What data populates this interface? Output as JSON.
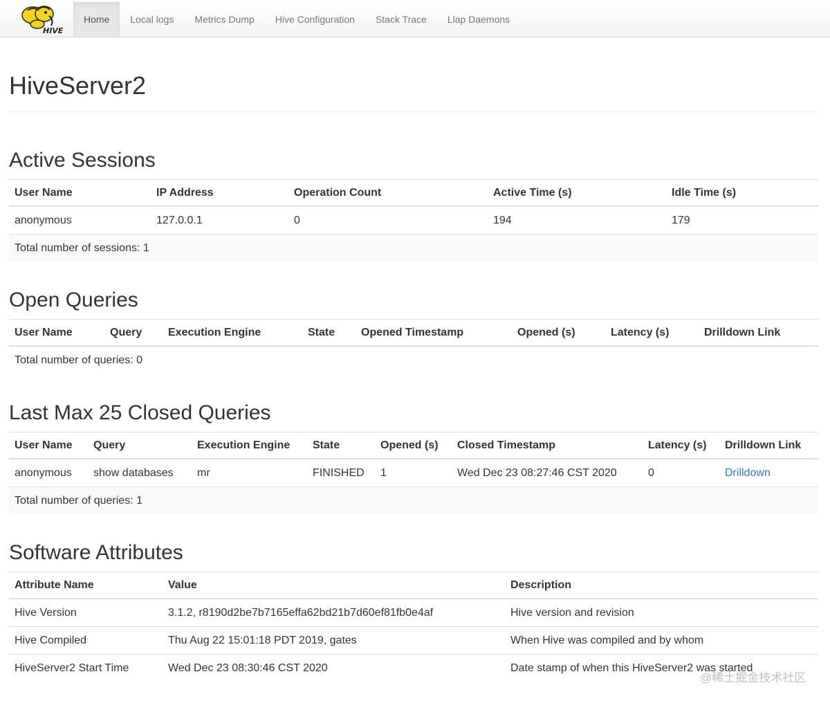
{
  "nav": {
    "logo_text": "HIVE",
    "items": [
      "Home",
      "Local logs",
      "Metrics Dump",
      "Hive Configuration",
      "Stack Trace",
      "Llap Daemons"
    ],
    "active": "Home"
  },
  "page_title": "HiveServer2",
  "active_sessions": {
    "title": "Active Sessions",
    "columns": [
      "User Name",
      "IP Address",
      "Operation Count",
      "Active Time (s)",
      "Idle Time (s)"
    ],
    "rows": [
      [
        "anonymous",
        "127.0.0.1",
        "0",
        "194",
        "179"
      ]
    ],
    "footer": "Total number of sessions: 1"
  },
  "open_queries": {
    "title": "Open Queries",
    "columns": [
      "User Name",
      "Query",
      "Execution Engine",
      "State",
      "Opened Timestamp",
      "Opened (s)",
      "Latency (s)",
      "Drilldown Link"
    ],
    "rows": [],
    "footer": "Total number of queries: 0"
  },
  "closed_queries": {
    "title": "Last Max 25 Closed Queries",
    "columns": [
      "User Name",
      "Query",
      "Execution Engine",
      "State",
      "Opened (s)",
      "Closed Timestamp",
      "Latency (s)",
      "Drilldown Link"
    ],
    "rows": [
      [
        "anonymous",
        "show databases",
        "mr",
        "FINISHED",
        "1",
        "Wed Dec 23 08:27:46 CST 2020",
        "0",
        "Drilldown"
      ]
    ],
    "footer": "Total number of queries: 1"
  },
  "software_attributes": {
    "title": "Software Attributes",
    "columns": [
      "Attribute Name",
      "Value",
      "Description"
    ],
    "rows": [
      [
        "Hive Version",
        "3.1.2, r8190d2be7b7165effa62bd21b7d60ef81fb0e4af",
        "Hive version and revision"
      ],
      [
        "Hive Compiled",
        "Thu Aug 22 15:01:18 PDT 2019, gates",
        "When Hive was compiled and by whom"
      ],
      [
        "HiveServer2 Start Time",
        "Wed Dec 23 08:30:46 CST 2020",
        "Date stamp of when this HiveServer2 was started"
      ]
    ]
  },
  "watermark": "@稀土掘金技术社区",
  "colors": {
    "link": "#337ab7",
    "logo_yellow": "#f7d21c"
  }
}
